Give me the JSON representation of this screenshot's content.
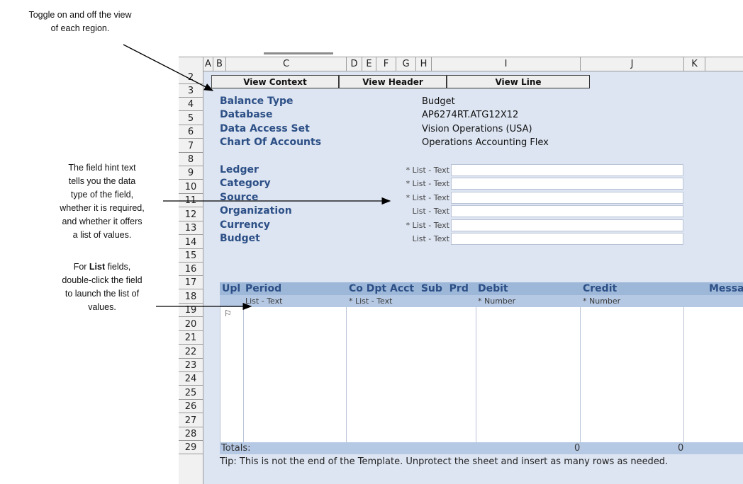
{
  "callouts": {
    "toggle": [
      "Toggle on and off the view",
      "of each region."
    ],
    "hint": [
      "The field hint text",
      "tells you the data",
      "type of the field,",
      "whether it is required,",
      "and whether it offers",
      "a list of values."
    ],
    "list": {
      "pre": "For ",
      "bold": "List",
      "post": " fields,",
      "lines": [
        "double-click the field",
        "to launch the list of",
        "values."
      ]
    }
  },
  "columns": [
    "A",
    "B",
    "C",
    "D",
    "E",
    "F",
    "G",
    "H",
    "I",
    "J",
    "K"
  ],
  "rows": [
    "2",
    "3",
    "4",
    "5",
    "6",
    "7",
    "8",
    "9",
    "10",
    "11",
    "12",
    "13",
    "14",
    "15",
    "16",
    "17",
    "18",
    "19",
    "20",
    "21",
    "22",
    "23",
    "24",
    "25",
    "26",
    "27",
    "28",
    "29"
  ],
  "toolbar": {
    "view_context": "View Context",
    "view_header": "View Header",
    "view_line": "View Line"
  },
  "context": [
    {
      "label": "Balance Type",
      "value": "Budget"
    },
    {
      "label": "Database",
      "value": "AP6274RT.ATG12X12"
    },
    {
      "label": "Data Access Set",
      "value": "Vision Operations (USA)"
    },
    {
      "label": "Chart Of Accounts",
      "value": "Operations Accounting Flex"
    }
  ],
  "header_fields": [
    {
      "label": "Ledger",
      "hint": "* List - Text"
    },
    {
      "label": "Category",
      "hint": "* List - Text"
    },
    {
      "label": "Source",
      "hint": "* List - Text"
    },
    {
      "label": "Organization",
      "hint": "List - Text"
    },
    {
      "label": "Currency",
      "hint": "* List - Text"
    },
    {
      "label": "Budget",
      "hint": "List - Text"
    }
  ],
  "line": {
    "headers": {
      "upl": "Upl",
      "period": "Period",
      "co": "Co Dpt Acct  Sub  Prd",
      "debit": "Debit",
      "credit": "Credit",
      "message": "Messa"
    },
    "hints": {
      "period": "List - Text",
      "co": "* List - Text",
      "debit": "* Number",
      "credit": "* Number"
    },
    "upl_flag": "⚐"
  },
  "totals": {
    "label": "Totals:",
    "debit": "0",
    "credit": "0"
  },
  "tip": "Tip: This is not the end of the Template.  Unprotect the sheet and insert as many rows as needed."
}
